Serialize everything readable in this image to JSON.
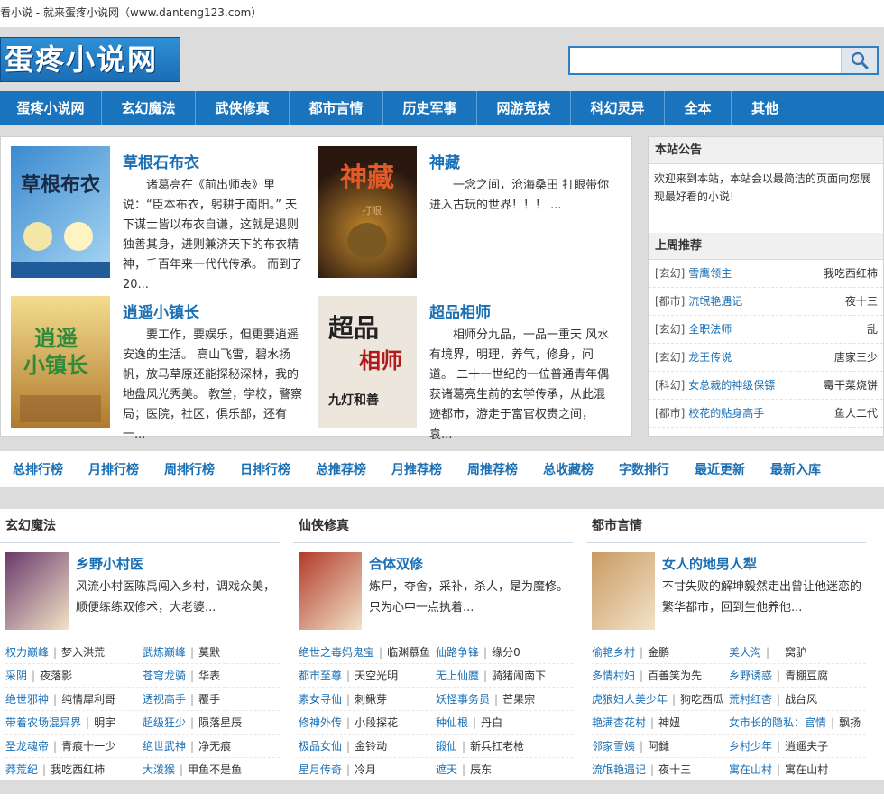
{
  "topbar": {
    "text": "看小说 - 就来蛋疼小说网（www.danteng123.com）"
  },
  "logo": {
    "text": "蛋疼小说网"
  },
  "search": {
    "placeholder": "",
    "button_icon": "search-icon"
  },
  "nav": [
    "蛋疼小说网",
    "玄幻魔法",
    "武侠修真",
    "都市言情",
    "历史军事",
    "网游竞技",
    "科幻灵异",
    "全本",
    "其他"
  ],
  "featured": [
    {
      "title": "草根石布衣",
      "desc": "诸葛亮在《前出师表》里说：“臣本布衣，躬耕于南阳。” 天下谋士皆以布衣自谦，这就是退则独善其身，进则兼济天下的布衣精神，千百年来一代代传承。 而到了20...",
      "cover_text": "草根石布衣",
      "cover_color": "#2e7bbf"
    },
    {
      "title": "神藏",
      "desc": "一念之间，沧海桑田 打眼带你进入古玩的世界！！！ ...",
      "cover_text": "神藏",
      "cover_color": "#3a2416"
    },
    {
      "title": "逍遥小镇长",
      "desc": "要工作，要娱乐，但更要逍遥安逸的生活。 高山飞雪，碧水扬帆，放马草原还能探秘深林，我的地盘风光秀美。 教堂，学校，警察局；医院，社区，俱乐部，还有一...",
      "cover_text": "逍遥小镇长",
      "cover_color": "#c9a24a"
    },
    {
      "title": "超品相师",
      "desc": "相师分九品，一品一重天 风水有境界，明理，养气，修身，问道。 二十一世纪的一位普通青年偶获诸葛亮生前的玄学传承，从此混迹都市，游走于富官权贵之间，袁...",
      "cover_text": "超品相师",
      "cover_color": "#e9e4dc"
    }
  ],
  "notice": {
    "title": "本站公告",
    "text": "欢迎来到本站，本站会以最简洁的页面向您展现最好看的小说!",
    "rec_title": "上周推荐",
    "rec": [
      {
        "cat": "[玄幻]",
        "name": "雪鹰领主",
        "author": "我吃西红柿"
      },
      {
        "cat": "[都市]",
        "name": "流氓艳遇记",
        "author": "夜十三"
      },
      {
        "cat": "[玄幻]",
        "name": "全职法师",
        "author": "乱"
      },
      {
        "cat": "[玄幻]",
        "name": "龙王传说",
        "author": "唐家三少"
      },
      {
        "cat": "[科幻]",
        "name": "女总裁的神级保镖",
        "author": "霉干菜烧饼"
      },
      {
        "cat": "[都市]",
        "name": "校花的贴身高手",
        "author": "鱼人二代"
      }
    ]
  },
  "rankbar": [
    "总排行榜",
    "月排行榜",
    "周排行榜",
    "日排行榜",
    "总推荐榜",
    "月推荐榜",
    "周推荐榜",
    "总收藏榜",
    "字数排行",
    "最近更新",
    "最新入库"
  ],
  "columns": [
    {
      "title": "玄幻魔法",
      "feature": {
        "title": "乡野小村医",
        "desc": "风流小村医陈禹闯入乡村，调戏众美，顺便练练双修术，大老婆...",
        "cover_color": "#6a3a6a"
      },
      "items": [
        {
          "n": "权力巅峰",
          "a": "梦入洪荒"
        },
        {
          "n": "武炼巅峰",
          "a": "莫默"
        },
        {
          "n": "采阴",
          "a": "夜落影"
        },
        {
          "n": "苍穹龙骑",
          "a": "华表"
        },
        {
          "n": "绝世邪神",
          "a": "纯情犀利哥"
        },
        {
          "n": "透视高手",
          "a": "覆手"
        },
        {
          "n": "带着农场混异界",
          "a": "明宇"
        },
        {
          "n": "超级狂少",
          "a": "陨落星辰"
        },
        {
          "n": "圣龙魂帝",
          "a": "青痕十一少"
        },
        {
          "n": "绝世武神",
          "a": "净无痕"
        },
        {
          "n": "莽荒纪",
          "a": "我吃西红柿"
        },
        {
          "n": "大泼猴",
          "a": "甲鱼不是鱼"
        }
      ]
    },
    {
      "title": "仙侠修真",
      "feature": {
        "title": "合体双修",
        "desc": "炼尸，夺舍，采补，杀人，是为魔修。 只为心中一点执着...",
        "cover_color": "#b23a2a"
      },
      "items": [
        {
          "n": "绝世之毒妈鬼宝",
          "a": "临渊慕鱼"
        },
        {
          "n": "仙路争锋",
          "a": "缘分0"
        },
        {
          "n": "都市至尊",
          "a": "天空光明"
        },
        {
          "n": "无上仙魔",
          "a": "骑猪闹南下"
        },
        {
          "n": "素女寻仙",
          "a": "刺鳅芽"
        },
        {
          "n": "妖怪事务员",
          "a": "芒果宗"
        },
        {
          "n": "修神外传",
          "a": "小段探花"
        },
        {
          "n": "种仙根",
          "a": "丹白"
        },
        {
          "n": "极品女仙",
          "a": "金铃动"
        },
        {
          "n": "锻仙",
          "a": "新兵扛老枪"
        },
        {
          "n": "星月传奇",
          "a": "冷月"
        },
        {
          "n": "遮天",
          "a": "辰东"
        }
      ]
    },
    {
      "title": "都市言情",
      "feature": {
        "title": "女人的地男人犁",
        "desc": "不甘失败的解坤毅然走出曾让他迷恋的繁华都市，回到生他养他...",
        "cover_color": "#c99a62"
      },
      "items": [
        {
          "n": "偷艳乡村",
          "a": "金鹏"
        },
        {
          "n": "美人沟",
          "a": "一窝驴"
        },
        {
          "n": "多情村妇",
          "a": "百善笑为先"
        },
        {
          "n": "乡野诱惑",
          "a": "青棚豆腐"
        },
        {
          "n": "虎狼妇人美少年",
          "a": "狗吃西瓜"
        },
        {
          "n": "荒村红杏",
          "a": "战台风"
        },
        {
          "n": "艳满杏花村",
          "a": "神妞"
        },
        {
          "n": "女市长的隐私：官情",
          "a": "飘扬"
        },
        {
          "n": "邻家雪姨",
          "a": "阿雠"
        },
        {
          "n": "乡村少年",
          "a": "逍遥夫子"
        },
        {
          "n": "流氓艳遇记",
          "a": "夜十三"
        },
        {
          "n": "寓在山村",
          "a": "寓在山村"
        }
      ]
    }
  ]
}
